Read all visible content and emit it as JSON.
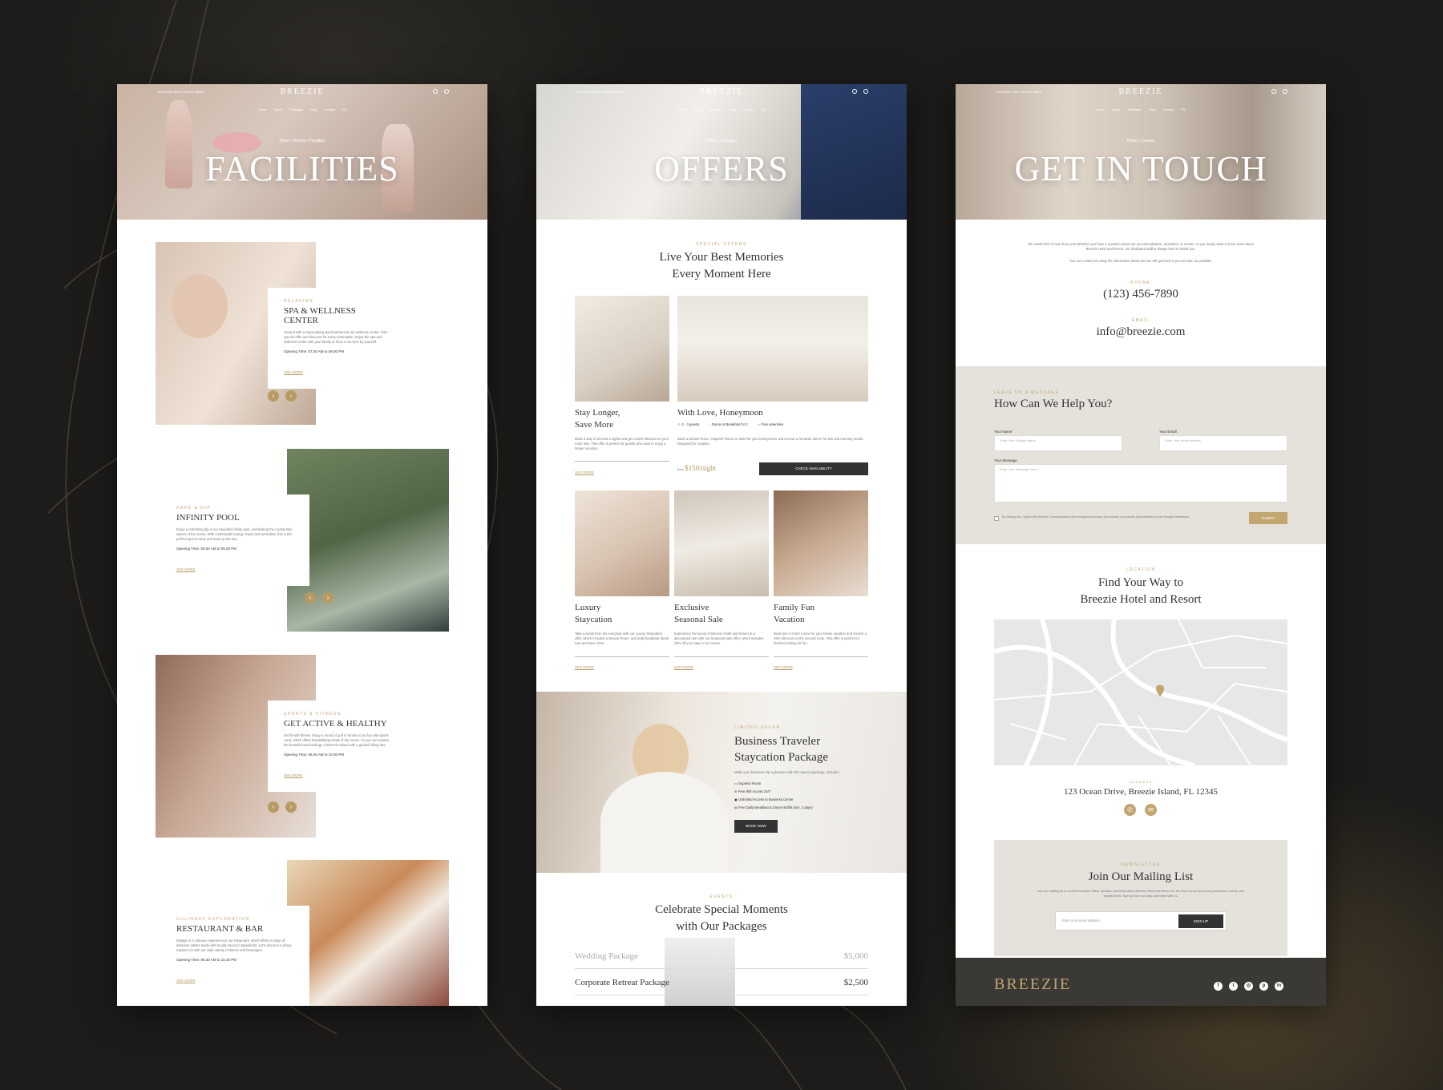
{
  "colors": {
    "background": "#1d1c1a",
    "accent_gold": "#b59a62",
    "dark": "#333333",
    "beige_section": "#e5e1db",
    "footer": "#3a3935"
  },
  "header": {
    "address": "123 Ocean Drive, Breezie Island",
    "logo": "BREEZIE",
    "nav": [
      "Home",
      "About",
      "Packages",
      "Blog",
      "Contact",
      "EN"
    ]
  },
  "facilities": {
    "hero_title": "FACILITIES",
    "breadcrumb": [
      "Home",
      "Rooms",
      "Facilities"
    ],
    "items": [
      {
        "eyebrow": "RELAXING",
        "title": "SPA & WELLNESS CENTER",
        "desc": "Unwind with a rejuvenating spa treatment at our wellness center. Visit special offer and discount for every reservation. Enjoy the spa and wellness center with your family or have a me-time by yourself.",
        "hours": "Opening Time: 07.00 AM to 08.00 PM",
        "link": "SEE MORE"
      },
      {
        "eyebrow": "HAKE & DIP",
        "title": "INFINITY POOL",
        "desc": "Enjoy a refreshing dip in our beautiful infinity pool, overlooking the crystal-blue waters of the ocean. With comfortable lounge chairs and umbrellas, this is the perfect spot to relax and soak up the sun.",
        "hours": "Opening Time: 05.00 AM to 05.00 PM",
        "link": "SEE MORE"
      },
      {
        "eyebrow": "SPORTS & FITNESS",
        "title": "GET ACTIVE & HEALTHY",
        "desc": "Get fit with fitness. Enjoy a round of golf or tennis at our fun villa sports court, which offers breathtaking views of the ocean. Or you can explore the beautiful surroundings of Breezie Island with a guided hiking tour.",
        "hours": "Opening Time: 06.00 AM to 10.00 PM",
        "link": "SEE MORE"
      },
      {
        "eyebrow": "CULINARY EXPLORATION",
        "title": "RESTAURANT & BAR",
        "desc": "Indulge in a culinary experience at our restaurant, which offers a range of delicious dishes made with locally sourced ingredients. Let's discover culinary explorer on with our wide variety of dishes and beverages.",
        "hours": "Opening Time: 05.30 AM to 10.30 PM",
        "link": "SEE MORE"
      }
    ]
  },
  "offers": {
    "hero_title": "OFFERS",
    "breadcrumb": [
      "Home",
      "Packages"
    ],
    "eyebrow": "SPECIAL OFFERS",
    "heading_l1": "Live Your Best Memories",
    "heading_l2": "Every Moment Here",
    "cards": [
      {
        "title_l1": "Stay Longer,",
        "title_l2": "Save More",
        "desc": "Book a stay of at least 5 nights and get a 20% discount on your room rate. This offer is perfect for guests who want to enjoy a longer vacation.",
        "link": "SEE MORE"
      },
      {
        "title": "With Love, Honeymoon",
        "features": [
          "2 - 3 guests",
          "Dinner & Breakfast for 2",
          "Free amenities"
        ],
        "desc": "Book a Deluxe Room, Superior Room or Suite for your honeymoon and receive a romantic dinner for two and morning meals. Designed for couples.",
        "from": "from",
        "price": "$150/night",
        "cta": "CHECK AVAILABILITY"
      },
      {
        "title_l1": "Luxury",
        "title_l2": "Staycation",
        "desc": "Take a break from the everyday with our Luxury Staycation offer, which includes a Deluxe Room, and daily breakfast. Book now and save 15%!",
        "link": "SEE MORE"
      },
      {
        "title_l1": "Exclusive",
        "title_l2": "Seasonal Sale",
        "desc": "Experience the luxury of Breezie Hotel and Resort at a discounted rate with our Seasonal Sale offer, which includes 25% off your stay in our rooms.",
        "link": "SEE MORE"
      },
      {
        "title_l1": "Family Fun",
        "title_l2": "Vacation",
        "desc": "Book two or more rooms for your family vacation and receive a 15% discount on the second room. This offer is perfect for families looking for fun.",
        "link": "SEE MORE"
      }
    ],
    "business": {
      "eyebrow": "LIMITED OFFER",
      "title_l1": "Business Traveler",
      "title_l2": "Staycation Package",
      "intro": "Make your business trip a pleasure with this special package. Includes:",
      "features": [
        "Superior Room",
        "Free Wifi Access 24/7",
        "Unlimited Access to Business Center",
        "Free Daily Breakfast & Dinner Buffet (min. 2 days)"
      ],
      "cta": "BOOK NOW"
    },
    "events": {
      "eyebrow": "EVENTS",
      "heading_l1": "Celebrate Special Moments",
      "heading_l2": "with Our Packages",
      "packages": [
        {
          "name": "Wedding Package",
          "price": "$5,000"
        },
        {
          "name": "Corporate Retreat Package",
          "price": "$2,500"
        }
      ]
    }
  },
  "contact": {
    "hero_title": "GET IN TOUCH",
    "breadcrumb": [
      "Home",
      "Contact"
    ],
    "intro_1": "We would love to hear from you! Whether you have a question about our accommodations, amenities, or events, or you simply want to learn more about Breezie Hotel and Resort, our dedicated staff is always here to assist you.",
    "intro_2": "You can contact us using the information below and we will get back to you as soon as possible.",
    "phone_label": "PHONE",
    "phone": "(123) 456-7890",
    "email_label": "EMAIL",
    "email": "info@breezie.com",
    "form": {
      "eyebrow": "LEAVE US A MESSAGE",
      "title": "How Can We Help You?",
      "name_label": "Your Name",
      "name_ph": "Enter Your Display Name",
      "email_label": "Your Email",
      "email_ph": "Enter Your email address",
      "message_label": "Your Message",
      "message_ph": "Enter Your Message Here...",
      "consent": "By clicking this, I agree with Breezie Communications and recognize its privacy and cookies use policies and practices to send through newsletters.",
      "submit": "SUBMIT"
    },
    "location": {
      "eyebrow": "LOCATION",
      "heading_l1": "Find Your Way to",
      "heading_l2": "Breezie Hotel and Resort",
      "addr_label": "Address",
      "address": "123 Ocean Drive, Breezie Island, FL 12345"
    },
    "newsletter": {
      "eyebrow": "NEWSLETTER",
      "title": "Join Our Mailing List",
      "desc": "Join our mailing list to receive exclusive offers, updates, and news about Breezie Hotel and Resort. Be the first to know about our promotions, events, and special deals. Sign up now and stay connected with us.",
      "placeholder": "Enter your email address...",
      "cta": "SIGN UP"
    },
    "footer": {
      "logo": "BREEZIE",
      "socials": [
        "facebook-icon",
        "twitter-icon",
        "instagram-icon",
        "pinterest-icon",
        "linkedin-icon"
      ]
    }
  }
}
